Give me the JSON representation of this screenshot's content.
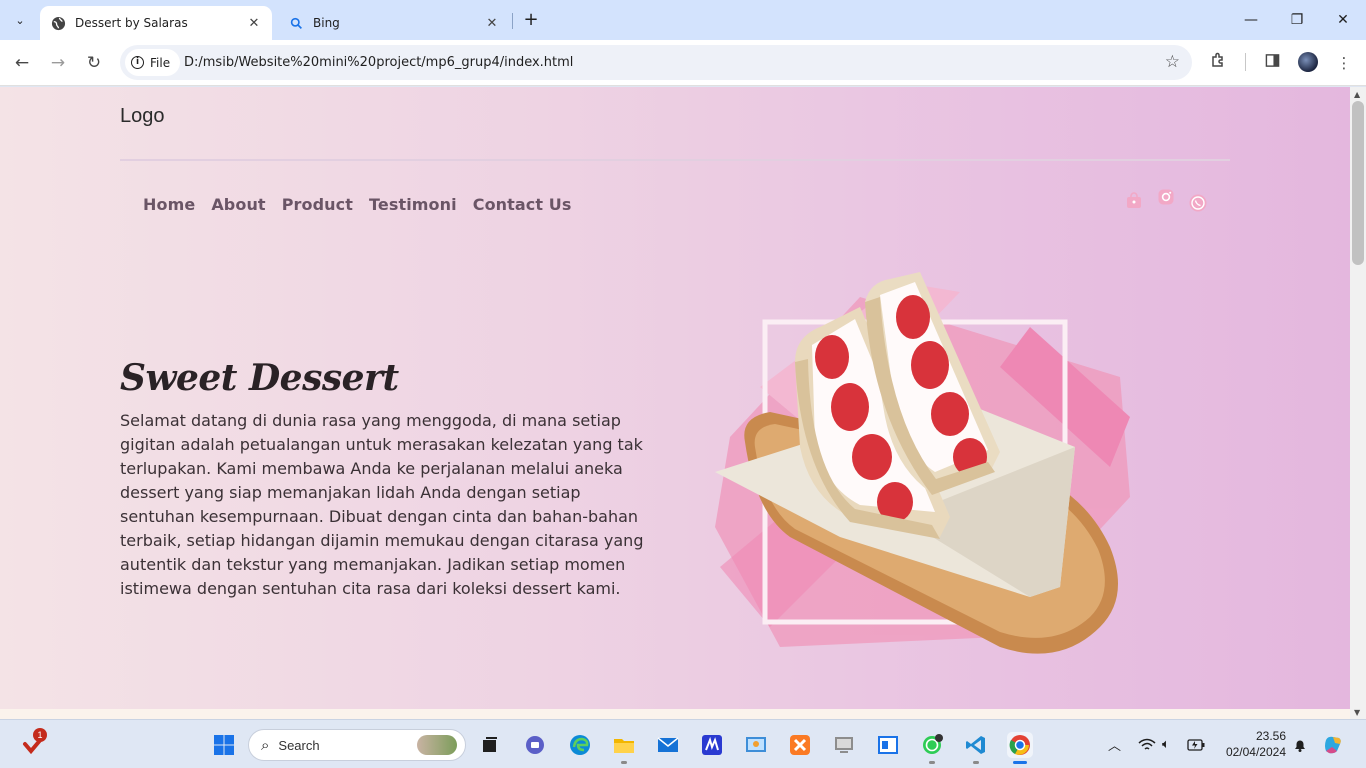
{
  "browser": {
    "tabs": [
      {
        "title": "Dessert by Salaras",
        "active": true,
        "icon": "globe-icon"
      },
      {
        "title": "Bing",
        "active": false,
        "icon": "search-icon"
      }
    ],
    "site_chip": "File",
    "url": "D:/msib/Website%20mini%20project/mp6_grup4/index.html"
  },
  "site": {
    "logo": "Logo",
    "nav": [
      "Home",
      "About",
      "Product",
      "Testimoni",
      "Contact Us"
    ],
    "social_icons": [
      "shopping-bag-icon",
      "instagram-icon",
      "whatsapp-icon"
    ],
    "hero": {
      "title": "Sweet Dessert",
      "text": "Selamat datang di dunia rasa yang menggoda, di mana setiap gigitan adalah petualangan untuk merasakan kelezatan yang tak terlupakan. Kami membawa Anda ke perjalanan melalui aneka dessert yang siap memanjakan lidah Anda dengan setiap sentuhan kesempurnaan. Dibuat dengan cinta dan bahan-bahan terbaik, setiap hidangan dijamin memukau dengan citarasa yang autentik dan tekstur yang memanjakan. Jadikan setiap momen istimewa dengan sentuhan cita rasa dari koleksi dessert kami."
    }
  },
  "taskbar": {
    "search_placeholder": "Search",
    "notification_count": "1",
    "time": "23.56",
    "date": "02/04/2024"
  },
  "colors": {
    "accent_pink": "#f2a8c6",
    "nav_text": "#6a5566",
    "page_gradient_start": "#f4e3e6",
    "page_gradient_end": "#e4b7de"
  }
}
